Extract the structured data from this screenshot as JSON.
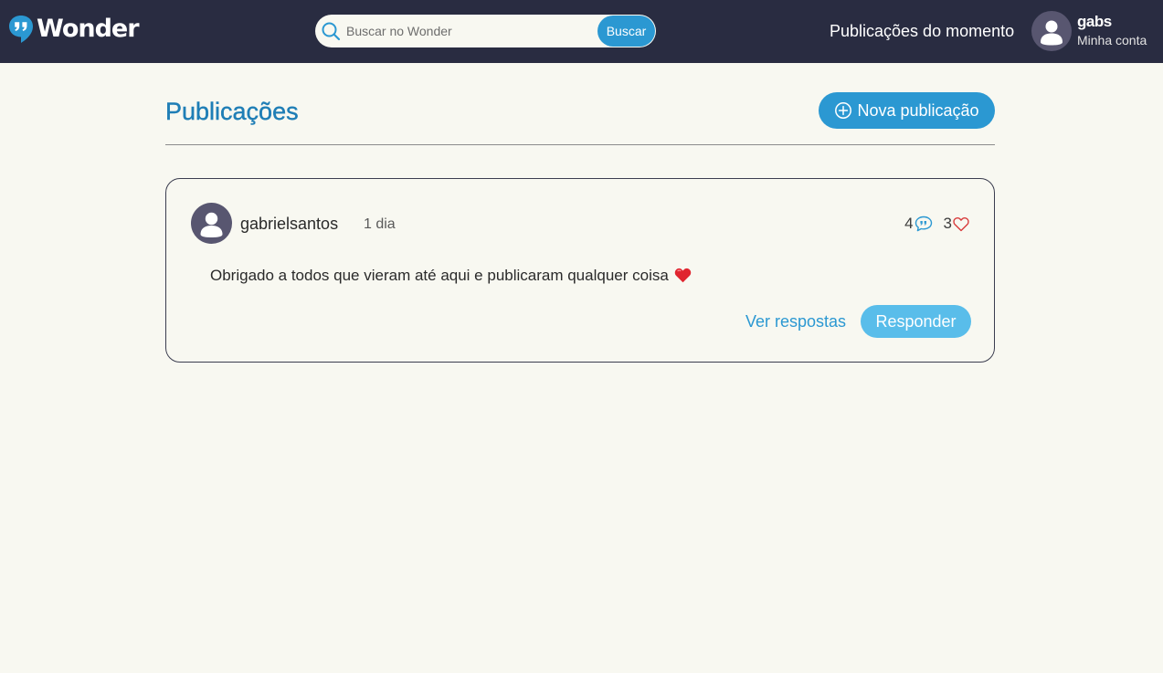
{
  "header": {
    "brand_name": "Wonder",
    "brand_icon": "quote-bubble-icon",
    "search": {
      "placeholder": "Buscar no Wonder",
      "value": "",
      "button_label": "Buscar",
      "icon": "search-icon"
    },
    "trending_label": "Publicações do momento",
    "account": {
      "username": "gabs",
      "subtitle": "Minha conta",
      "icon": "user-icon"
    }
  },
  "main": {
    "title": "Publicações",
    "new_post_label": "Nova publicação",
    "new_post_icon": "plus-circle-icon",
    "posts": [
      {
        "author": "gabrielsantos",
        "time": "1 dia",
        "text": "Obrigado a todos que vieram até aqui e publicaram qualquer coisa",
        "text_emoji": "heart-emoji",
        "reply_count": "4",
        "like_count": "3",
        "view_replies_label": "Ver respostas",
        "reply_label": "Responder"
      }
    ]
  },
  "colors": {
    "navbar_bg": "#292c41",
    "page_bg": "#f8f8f1",
    "accent": "#2b98d2",
    "title": "#1f7eb6",
    "reply_button": "#59bdea",
    "like": "#d83b3b"
  }
}
